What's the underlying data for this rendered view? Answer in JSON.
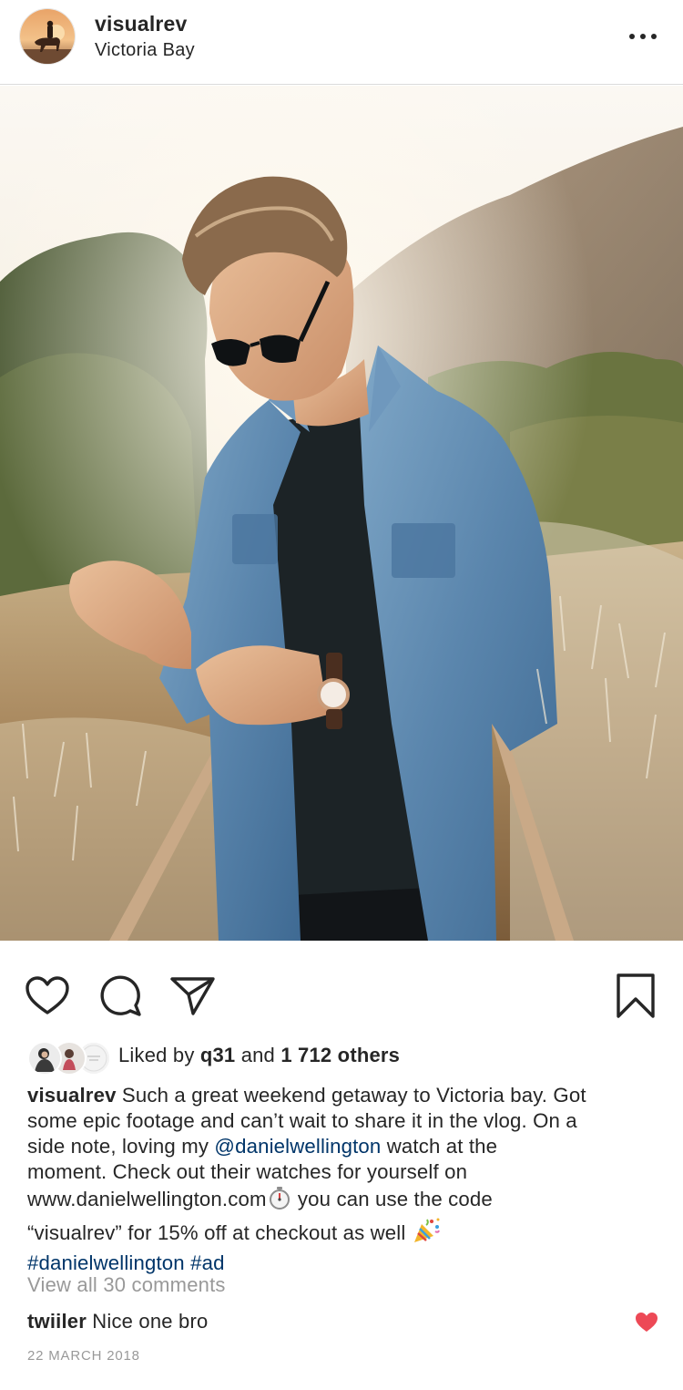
{
  "post": {
    "username": "visualrev",
    "location": "Victoria Bay"
  },
  "icons": {
    "avatar": "profile-photo-horse-rider",
    "more": "more-options-icon",
    "like": "heart-outline-icon",
    "comment": "comment-bubble-icon",
    "share": "paper-plane-icon",
    "save": "bookmark-icon",
    "comment_like": "heart-filled-icon"
  },
  "colors": {
    "link": "#003569",
    "muted": "#999999",
    "text": "#262626",
    "heart": "#ed4956",
    "divider": "#dbdbdb"
  },
  "likes": {
    "prefix": "Liked by",
    "user": "q31",
    "joiner": "and",
    "others": "1 712 others"
  },
  "caption": {
    "username": "visualrev",
    "line1": "Such a great weekend getaway to Victoria bay. Got",
    "line2": "some epic footage and can’t wait to share it in the vlog. On a",
    "line3_pre": "side note, loving my",
    "line3_mention": "@danielwellington",
    "line3_post": "watch at the",
    "line4": "moment. Check out their watches for yourself on",
    "line5_url": "www.danielwellington.com",
    "line5_post": "you can use the code",
    "line6": "“visualrev” for 15% off at checkout as well",
    "hashtag1": "#danielwellington",
    "hashtag2": "#ad"
  },
  "comments": {
    "view_all": "View all 30 comments",
    "items": [
      {
        "user": "twiiler",
        "text": "Nice one bro"
      }
    ]
  },
  "date": "22 MARCH 2018"
}
